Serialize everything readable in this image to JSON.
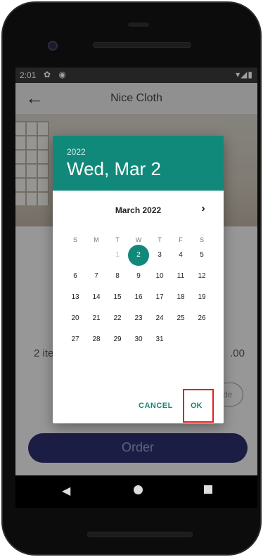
{
  "status_bar": {
    "time": "2:01",
    "left_icons": "✿ ◉",
    "right_icons": "▾◢▮"
  },
  "app_bar": {
    "title": "Nice Cloth",
    "back_glyph": "←"
  },
  "page": {
    "items_text": "2 ite",
    "price_text": ".00",
    "side_button_text": "de",
    "order_button": "Order"
  },
  "dialog": {
    "header_year": "2022",
    "header_date": "Wed, Mar 2",
    "month_label": "March 2022",
    "next_glyph": "›",
    "weekdays": [
      "S",
      "M",
      "T",
      "W",
      "T",
      "F",
      "S"
    ],
    "days": [
      "1",
      "2",
      "3",
      "4",
      "5",
      "6",
      "7",
      "8",
      "9",
      "10",
      "11",
      "12",
      "13",
      "14",
      "15",
      "16",
      "17",
      "18",
      "19",
      "20",
      "21",
      "22",
      "23",
      "24",
      "25",
      "26",
      "27",
      "28",
      "29",
      "30",
      "31"
    ],
    "selected_day": "2",
    "disabled_days": [
      "1"
    ],
    "cancel_label": "CANCEL",
    "ok_label": "OK"
  },
  "colors": {
    "accent": "#11897a",
    "order_button": "#2c2f6e",
    "highlight": "#e02020"
  },
  "icons": {
    "back": "back-arrow-icon",
    "next": "chevron-right-icon"
  }
}
